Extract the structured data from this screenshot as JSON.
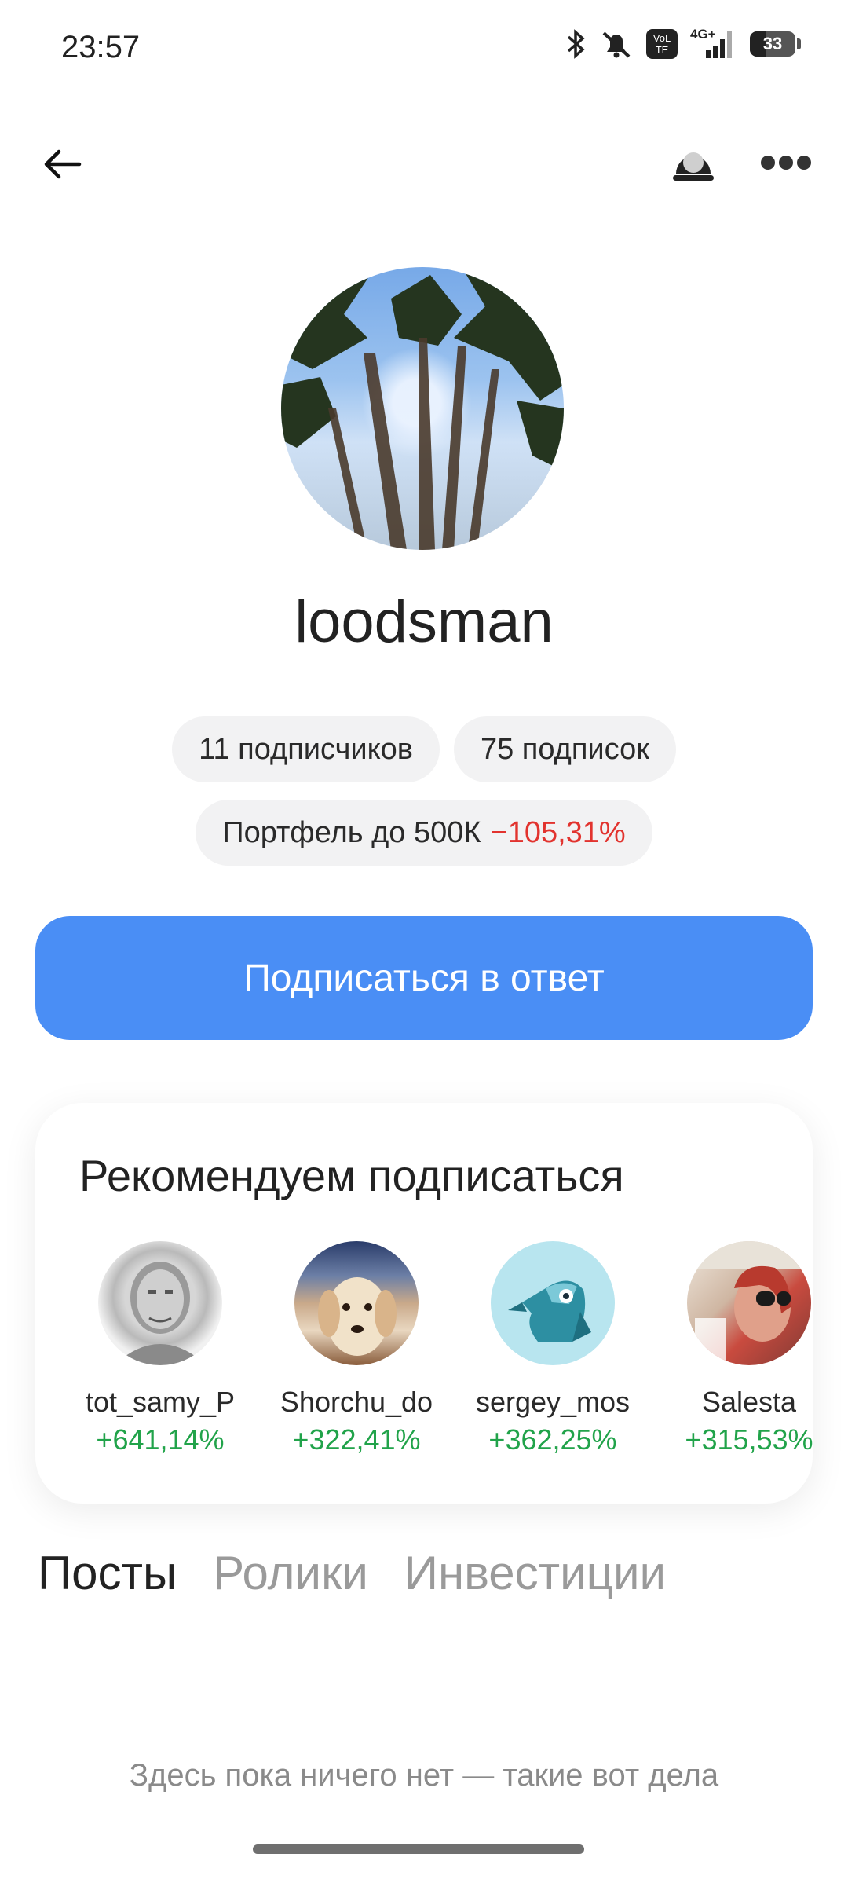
{
  "status_bar": {
    "time": "23:57",
    "battery": "33",
    "network": "4G+",
    "volte": "VoLTE"
  },
  "profile": {
    "username": "loodsman",
    "followers": "11 подписчиков",
    "following": "75 подписок",
    "portfolio_label": "Портфель до 500К",
    "portfolio_change": "−105,31%"
  },
  "actions": {
    "subscribe_back": "Подписаться в ответ"
  },
  "recommendations": {
    "title": "Рекомендуем подписаться",
    "items": [
      {
        "name": "tot_samy_P",
        "change": "+641,14%"
      },
      {
        "name": "Shorchu_do",
        "change": "+322,41%"
      },
      {
        "name": "sergey_mos",
        "change": "+362,25%"
      },
      {
        "name": "Salesta",
        "change": "+315,53%"
      }
    ]
  },
  "tabs": [
    {
      "label": "Посты",
      "active": true
    },
    {
      "label": "Ролики",
      "active": false
    },
    {
      "label": "Инвестиции",
      "active": false
    }
  ],
  "empty_state": "Здесь пока ничего нет — такие вот дела",
  "colors": {
    "accent": "#4a8ef5",
    "negative": "#e2332e",
    "positive": "#21a34a"
  }
}
